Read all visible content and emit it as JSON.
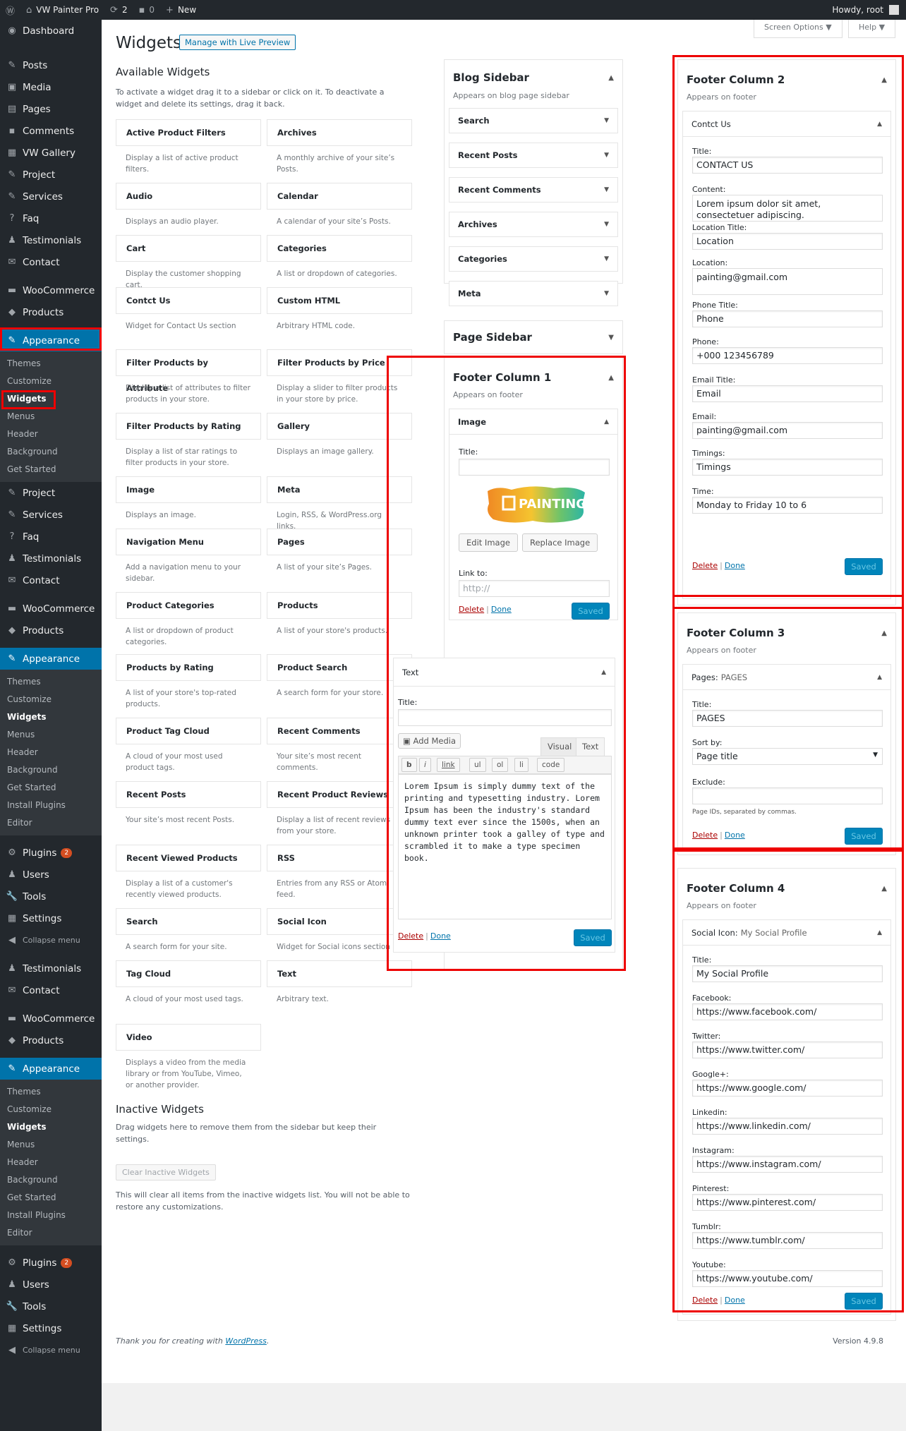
{
  "adminbar": {
    "wp_logo": "wordpress-icon",
    "site": "VW Painter Pro",
    "updates": "2",
    "comments": "0",
    "new": "New",
    "howdy": "Howdy, root"
  },
  "sidebar": {
    "block1": [
      {
        "label": "Dashboard",
        "icon": "dashboard-icon"
      },
      {
        "sep": true
      },
      {
        "label": "Posts",
        "icon": "pin-icon"
      },
      {
        "label": "Media",
        "icon": "media-icon"
      },
      {
        "label": "Pages",
        "icon": "pages-icon"
      },
      {
        "label": "Comments",
        "icon": "comment-icon"
      },
      {
        "label": "VW Gallery",
        "icon": "gallery-icon"
      },
      {
        "label": "Project",
        "icon": "pin-icon"
      },
      {
        "label": "Services",
        "icon": "pin-icon"
      },
      {
        "label": "Faq",
        "icon": "question-icon"
      },
      {
        "label": "Testimonials",
        "icon": "user-icon"
      },
      {
        "label": "Contact",
        "icon": "mail-icon"
      }
    ],
    "woocommerce": "WooCommerce",
    "products": "Products",
    "appearance": "Appearance",
    "sub1": [
      "Themes",
      "Customize",
      "Widgets",
      "Menus",
      "Header",
      "Background",
      "Get Started"
    ],
    "block2": [
      "Project",
      "Services",
      "Faq",
      "Testimonials",
      "Contact"
    ],
    "sub2": [
      "Themes",
      "Customize",
      "Widgets",
      "Menus",
      "Header",
      "Background",
      "Get Started",
      "Install Plugins",
      "Editor"
    ],
    "plugins": "Plugins",
    "plugins_badge": "2",
    "users": "Users",
    "tools": "Tools",
    "settings": "Settings",
    "collapse": "Collapse menu",
    "block3": [
      "Testimonials",
      "Contact"
    ]
  },
  "page": {
    "title": "Widgets",
    "preview_btn": "Manage with Live Preview",
    "screen_options": "Screen Options ▼",
    "help": "Help ▼"
  },
  "available": {
    "heading": "Available Widgets",
    "desc": "To activate a widget drag it to a sidebar or click on it. To deactivate a widget and delete its settings, drag it back.",
    "widgets": [
      [
        "Active Product Filters",
        "Display a list of active product filters."
      ],
      [
        "Archives",
        "A monthly archive of your site’s Posts."
      ],
      [
        "Audio",
        "Displays an audio player."
      ],
      [
        "Calendar",
        "A calendar of your site’s Posts."
      ],
      [
        "Cart",
        "Display the customer shopping cart."
      ],
      [
        "Categories",
        "A list or dropdown of categories."
      ],
      [
        "Contct Us",
        "Widget for Contact Us section"
      ],
      [
        "Custom HTML",
        "Arbitrary HTML code."
      ],
      [
        "Filter Products by Attribute",
        "Display a list of attributes to filter products in your store."
      ],
      [
        "Filter Products by Price",
        "Display a slider to filter products in your store by price."
      ],
      [
        "Filter Products by Rating",
        "Display a list of star ratings to filter products in your store."
      ],
      [
        "Gallery",
        "Displays an image gallery."
      ],
      [
        "Image",
        "Displays an image."
      ],
      [
        "Meta",
        "Login, RSS, & WordPress.org links."
      ],
      [
        "Navigation Menu",
        "Add a navigation menu to your sidebar."
      ],
      [
        "Pages",
        "A list of your site’s Pages."
      ],
      [
        "Product Categories",
        "A list or dropdown of product categories."
      ],
      [
        "Products",
        "A list of your store's products."
      ],
      [
        "Products by Rating",
        "A list of your store's top-rated products."
      ],
      [
        "Product Search",
        "A search form for your store."
      ],
      [
        "Product Tag Cloud",
        "A cloud of your most used product tags."
      ],
      [
        "Recent Comments",
        "Your site’s most recent comments."
      ],
      [
        "Recent Posts",
        "Your site’s most recent Posts."
      ],
      [
        "Recent Product Reviews",
        "Display a list of recent reviews from your store."
      ],
      [
        "Recent Viewed Products",
        "Display a list of a customer's recently viewed products."
      ],
      [
        "RSS",
        "Entries from any RSS or Atom feed."
      ],
      [
        "Search",
        "A search form for your site."
      ],
      [
        "Social Icon",
        "Widget for Social icons section"
      ],
      [
        "Tag Cloud",
        "A cloud of your most used tags."
      ],
      [
        "Text",
        "Arbitrary text."
      ],
      [
        "Video",
        "Displays a video from the media library or from YouTube, Vimeo, or another provider."
      ]
    ]
  },
  "inactive": {
    "heading": "Inactive Widgets",
    "desc": "Drag widgets here to remove them from the sidebar but keep their settings.",
    "clear_btn": "Clear Inactive Widgets",
    "clear_desc": "This will clear all items from the inactive widgets list. You will not be able to restore any customizations."
  },
  "blog_sidebar": {
    "title": "Blog Sidebar",
    "desc": "Appears on blog page sidebar",
    "items": [
      "Search",
      "Recent Posts",
      "Recent Comments",
      "Archives",
      "Categories",
      "Meta"
    ]
  },
  "page_sidebar": {
    "title": "Page Sidebar"
  },
  "footer1": {
    "title": "Footer Column 1",
    "desc": "Appears on footer",
    "image": {
      "name": "Image",
      "title_label": "Title:",
      "logo_text": "PAINTING",
      "edit": "Edit Image",
      "replace": "Replace Image",
      "link_label": "Link to:",
      "link_ph": "http://"
    },
    "text": {
      "name": "Text",
      "title_label": "Title:",
      "add_media": "Add Media",
      "visual": "Visual",
      "text_tab": "Text",
      "buttons": [
        "b",
        "i",
        "link",
        "ul",
        "ol",
        "li",
        "code"
      ],
      "content": "Lorem Ipsum is simply dummy text of the printing and typesetting industry. Lorem Ipsum has been the industry's standard dummy text ever since the 1500s, when an unknown printer took a galley of type and scrambled it to make a type specimen book."
    }
  },
  "footer2": {
    "title": "Footer Column 2",
    "desc": "Appears on footer",
    "widget": "Contct Us",
    "fields": [
      [
        "Title:",
        "CONTACT US"
      ],
      [
        "Content:",
        "Lorem ipsum dolor sit amet, consectetuer adipiscing."
      ],
      [
        "Location Title:",
        "Location"
      ],
      [
        "Location:",
        "painting@gmail.com"
      ],
      [
        "Phone Title:",
        "Phone"
      ],
      [
        "Phone:",
        "+000 123456789"
      ],
      [
        "Email Title:",
        "Email"
      ],
      [
        "Email:",
        "painting@gmail.com"
      ],
      [
        "Timings:",
        "Timings"
      ],
      [
        "Time:",
        "Monday to Friday 10 to 6"
      ]
    ]
  },
  "footer3": {
    "title": "Footer Column 3",
    "desc": "Appears on footer",
    "widget": "Pages:",
    "widget_sub": "PAGES",
    "title_label": "Title:",
    "title_val": "PAGES",
    "sort_label": "Sort by:",
    "sort_val": "Page title",
    "exclude_label": "Exclude:",
    "exclude_hint": "Page IDs, separated by commas."
  },
  "footer4": {
    "title": "Footer Column 4",
    "desc": "Appears on footer",
    "widget": "Social Icon:",
    "widget_sub": "My Social Profile",
    "fields": [
      [
        "Title:",
        "My Social Profile"
      ],
      [
        "Facebook:",
        "https://www.facebook.com/"
      ],
      [
        "Twitter:",
        "https://www.twitter.com/"
      ],
      [
        "Google+:",
        "https://www.google.com/"
      ],
      [
        "Linkedin:",
        "https://www.linkedin.com/"
      ],
      [
        "Instagram:",
        "https://www.instagram.com/"
      ],
      [
        "Pinterest:",
        "https://www.pinterest.com/"
      ],
      [
        "Tumblr:",
        "https://www.tumblr.com/"
      ],
      [
        "Youtube:",
        "https://www.youtube.com/"
      ]
    ]
  },
  "common": {
    "delete": "Delete",
    "done": "Done",
    "saved": "Saved",
    "sep": "|"
  },
  "footer": {
    "thanks": "Thank you for creating with ",
    "wp": "WordPress",
    "thanks_end": ".",
    "version": "Version 4.9.8"
  }
}
